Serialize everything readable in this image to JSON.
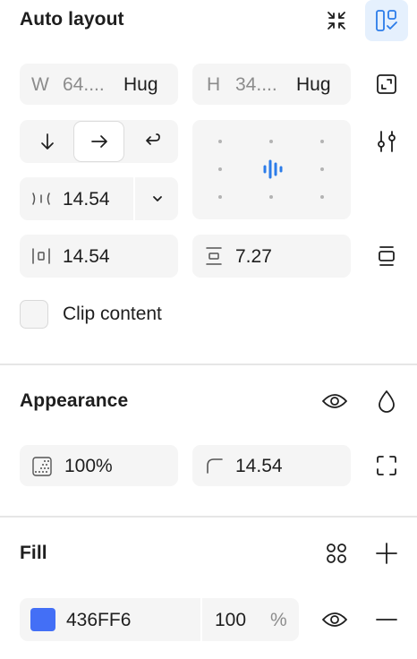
{
  "auto_layout": {
    "title": "Auto layout",
    "width_prefix": "W",
    "width_value": "64....",
    "width_mode": "Hug",
    "height_prefix": "H",
    "height_value": "34....",
    "height_mode": "Hug",
    "gap_value": "14.54",
    "horizontal_padding": "14.54",
    "vertical_padding": "7.27",
    "clip_content_label": "Clip content",
    "clip_content_checked": false,
    "direction_selected": "horizontal"
  },
  "appearance": {
    "title": "Appearance",
    "opacity": "100%",
    "corner_radius": "14.54"
  },
  "fill": {
    "title": "Fill",
    "color_hex": "436FF6",
    "swatch_color": "#436FF6",
    "opacity": "100",
    "opacity_unit": "%"
  },
  "colors": {
    "accent": "#2B7CE9",
    "accent_bg": "#E5F0FD",
    "field_bg": "#F5F5F5"
  }
}
